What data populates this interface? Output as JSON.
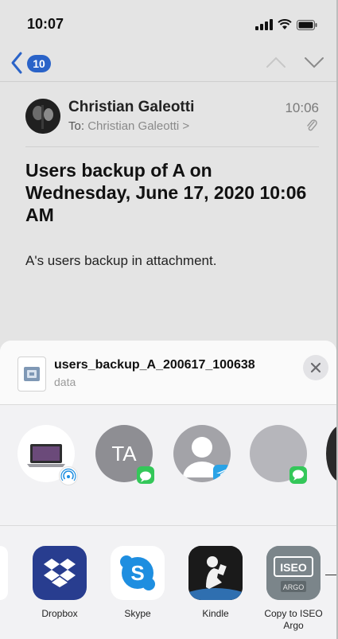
{
  "status_bar": {
    "time": "10:07"
  },
  "nav": {
    "unread_count": "10"
  },
  "email": {
    "sender": "Christian Galeotti",
    "to_prefix": "To: ",
    "recipient": "Christian Galeotti >",
    "time": "10:06",
    "subject": "Users backup of A on Wednesday, June 17, 2020 10:06 AM",
    "body": "A's users backup in attachment."
  },
  "share_sheet": {
    "file_name": "users_backup_A_200617_100638",
    "file_type": "data",
    "people": [
      {
        "initials": ""
      },
      {
        "initials": "TA"
      },
      {
        "initials": ""
      },
      {
        "initials": ""
      }
    ],
    "apps": [
      {
        "label": "Dropbox"
      },
      {
        "label": "Skype"
      },
      {
        "label": "Kindle"
      },
      {
        "label": "Copy to ISEO Argo"
      }
    ],
    "iseo_icon_text_top": "ISEO",
    "iseo_icon_text_bottom": "ARGO"
  },
  "colors": {
    "badge_blue": "#2a63c8",
    "messages_green": "#34c759",
    "telegram_blue": "#2aa3e6",
    "dropbox_blue": "#283d8f",
    "skype_blue": "#1e8ee0",
    "dimmed_background": "#e4e4e4",
    "sheet_background": "#f2f2f4"
  }
}
